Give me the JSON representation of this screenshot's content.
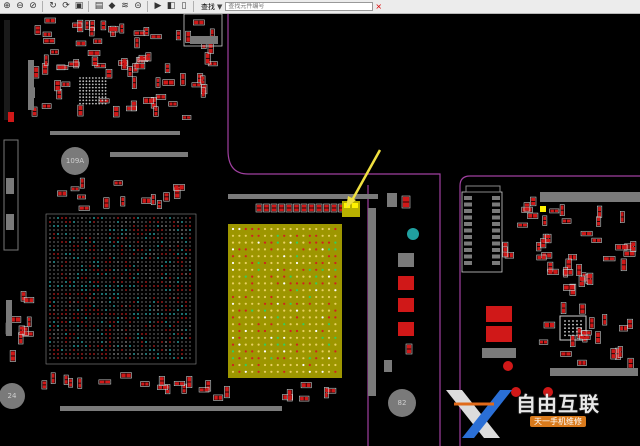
{
  "toolbar": {
    "buttons": [
      {
        "name": "zoom-in",
        "glyph": "⊕"
      },
      {
        "name": "zoom-out",
        "glyph": "⊖"
      },
      {
        "name": "zoom-fit",
        "glyph": "⊘"
      },
      {
        "name": "refresh",
        "glyph": "↻"
      },
      {
        "name": "rotate",
        "glyph": "⟳"
      },
      {
        "name": "layers",
        "glyph": "▣"
      },
      {
        "name": "print",
        "glyph": "▤"
      },
      {
        "name": "highlight",
        "glyph": "◆"
      },
      {
        "name": "net",
        "glyph": "≋"
      },
      {
        "name": "stop",
        "glyph": "⊝"
      },
      {
        "name": "pointer",
        "glyph": "▶"
      },
      {
        "name": "side-view",
        "glyph": "◧"
      },
      {
        "name": "mouse",
        "glyph": "▯"
      }
    ],
    "find_label": "查找",
    "find_placeholder": "查找元件编号",
    "close_glyph": "×"
  },
  "board": {
    "chip_labels": {
      "left_chip": "109A",
      "bottom_left": "24",
      "bottom_center": "82"
    },
    "colors": {
      "background": "#000000",
      "outline": "#a040a0",
      "pad_red": "#d01818",
      "pad_gray": "#7a7a7a",
      "highlight": "#b8b000",
      "pointer": "#f0e040",
      "teal": "#20a0a0"
    }
  },
  "watermark": {
    "brand": "自由互联",
    "tagline": "天一手机维修"
  }
}
